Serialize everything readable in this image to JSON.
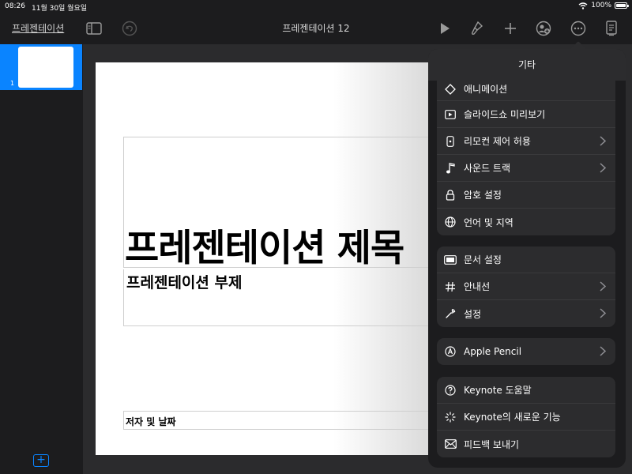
{
  "status": {
    "time": "08:26",
    "date": "11월 30일 월요일",
    "battery": "100%",
    "battery_level": 1.0
  },
  "toolbar": {
    "back_link": "프레젠테이션",
    "doc_title": "프레젠테이션 12"
  },
  "sidebar": {
    "slide_number": "1",
    "add_slide": "+"
  },
  "slide": {
    "title": "프레젠테이션 제목",
    "subtitle": "프레젠테이션 부제",
    "author": "저자 및 날짜"
  },
  "popover": {
    "title": "기타",
    "groups": [
      [
        {
          "label": "애니메이션",
          "icon": "animation-icon",
          "chevron": false
        },
        {
          "label": "슬라이드쇼 미리보기",
          "icon": "play-preview-icon",
          "chevron": false
        },
        {
          "label": "리모컨 제어 허용",
          "icon": "remote-icon",
          "chevron": true
        },
        {
          "label": "사운드 트랙",
          "icon": "music-note-icon",
          "chevron": true
        },
        {
          "label": "암호 설정",
          "icon": "lock-icon",
          "chevron": false
        },
        {
          "label": "언어 및 지역",
          "icon": "globe-icon",
          "chevron": false
        }
      ],
      [
        {
          "label": "문서 설정",
          "icon": "document-setup-icon",
          "chevron": false
        },
        {
          "label": "안내선",
          "icon": "guides-icon",
          "chevron": true
        },
        {
          "label": "설정",
          "icon": "wrench-icon",
          "chevron": true
        }
      ],
      [
        {
          "label": "Apple Pencil",
          "icon": "pencil-circle-icon",
          "chevron": true
        }
      ],
      [
        {
          "label": "Keynote 도움말",
          "icon": "help-icon",
          "chevron": false
        },
        {
          "label": "Keynote의 새로운 기능",
          "icon": "sparkle-icon",
          "chevron": false
        },
        {
          "label": "피드백 보내기",
          "icon": "envelope-icon",
          "chevron": false
        }
      ]
    ]
  }
}
